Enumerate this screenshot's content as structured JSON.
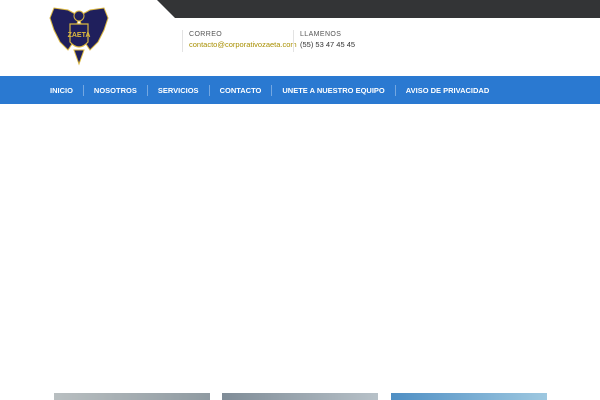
{
  "header": {
    "logo_text": "ZAETA",
    "contact": {
      "email_label": "CORREO",
      "email_value": "contacto@corporativozaeta.com",
      "phone_label": "LLAMENOS",
      "phone_value": "(55) 53 47 45 45"
    }
  },
  "nav": {
    "items": [
      {
        "label": "INICIO"
      },
      {
        "label": "NOSOTROS"
      },
      {
        "label": "SERVICIOS"
      },
      {
        "label": "CONTACTO"
      },
      {
        "label": "UNETE A NUESTRO EQUIPO"
      },
      {
        "label": "AVISO DE PRIVACIDAD"
      }
    ]
  },
  "colors": {
    "topbar": "#333436",
    "nav_bg": "#2a79d1",
    "email_accent": "#a88f00",
    "logo_navy": "#1f1f5c",
    "logo_gold": "#d9b640"
  }
}
